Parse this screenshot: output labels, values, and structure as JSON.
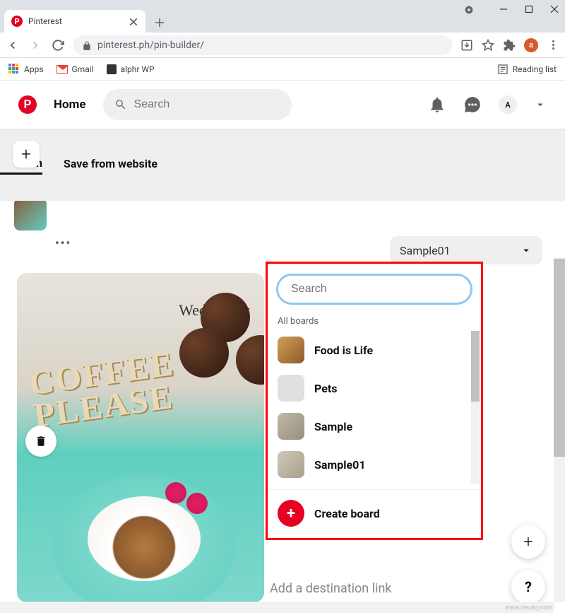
{
  "browser": {
    "tab_title": "Pinterest",
    "url": "pinterest.ph/pin-builder/",
    "avatar_letter": "a",
    "bookmarks": {
      "apps": "Apps",
      "gmail": "Gmail",
      "alphr": "alphr WP",
      "reading": "Reading list"
    }
  },
  "pinterest": {
    "home": "Home",
    "search_placeholder": "Search",
    "avatar": "A",
    "tabs": {
      "create_partial": "at       n",
      "save_from_web": "Save from website"
    },
    "selected_board": "Sample01",
    "pin": {
      "day": "Wednesday",
      "line1": "COFFEE",
      "line2": "PLEASE"
    },
    "dropdown": {
      "search_placeholder": "Search",
      "section": "All boards",
      "boards": [
        {
          "name": "Food is Life"
        },
        {
          "name": "Pets"
        },
        {
          "name": "Sample"
        },
        {
          "name": "Sample01"
        }
      ],
      "create": "Create board"
    },
    "destination_placeholder": "Add a destination link",
    "help": "?"
  },
  "watermark": "www.deuaq.com"
}
